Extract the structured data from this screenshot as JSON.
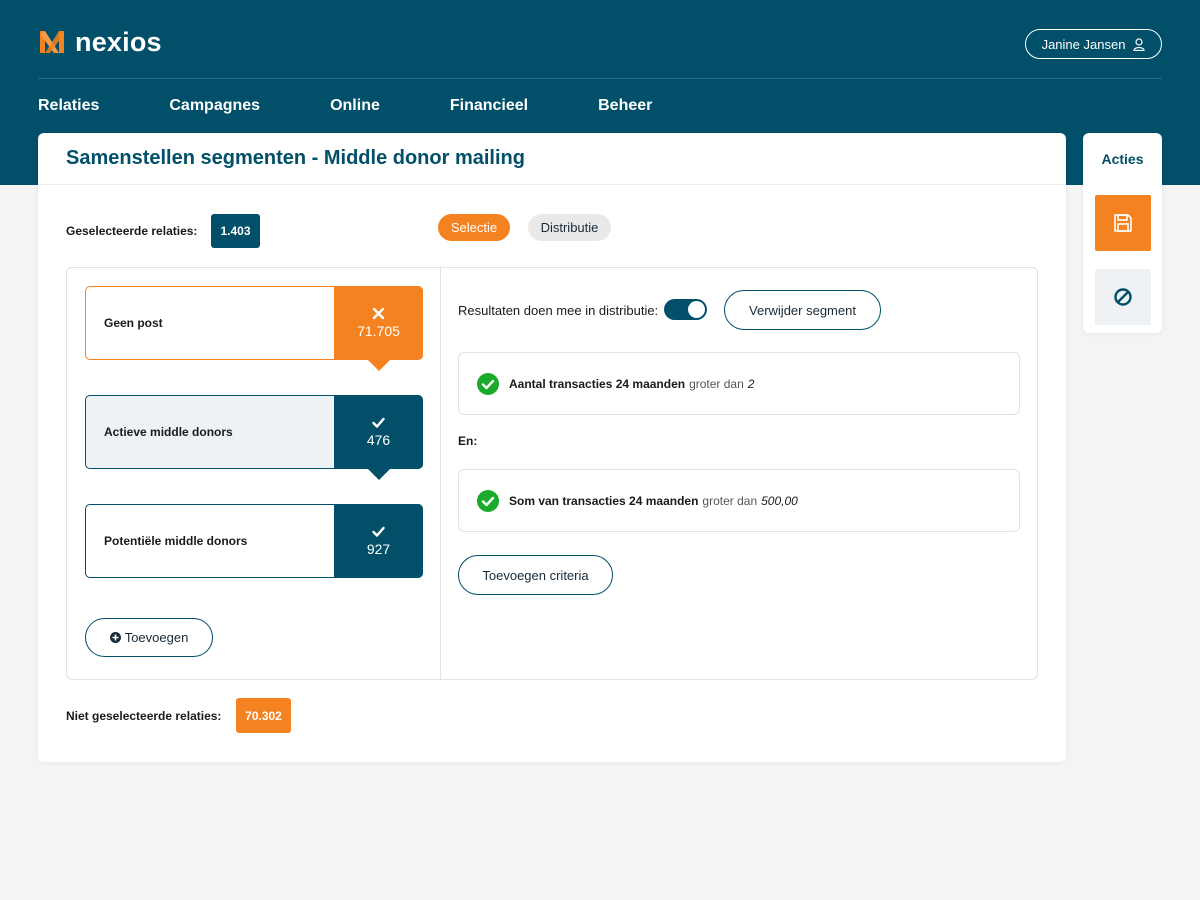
{
  "app": {
    "brand": "nexios",
    "user_name": "Janine Jansen"
  },
  "nav": [
    "Relaties",
    "Campagnes",
    "Online",
    "Financieel",
    "Beheer"
  ],
  "page": {
    "title": "Samenstellen segmenten - Middle donor mailing"
  },
  "selection": {
    "selected_label": "Geselecteerde relaties:",
    "selected_count": "1.403",
    "not_selected_label": "Niet geselecteerde relaties:",
    "not_selected_count": "70.302"
  },
  "tabs": {
    "selectie": "Selectie",
    "distributie": "Distributie"
  },
  "segments": [
    {
      "label": "Geen post",
      "count": "71.705",
      "icon": "x-icon"
    },
    {
      "label": "Actieve middle donors",
      "count": "476",
      "icon": "check-icon"
    },
    {
      "label": "Potentiële middle donors",
      "count": "927",
      "icon": "check-icon"
    }
  ],
  "add_button": "Toevoegen",
  "detail": {
    "results_label": "Resultaten doen mee in distributie:",
    "toggle_on": true,
    "delete_button": "Verwijder segment",
    "and_label": "En:",
    "add_criteria_button": "Toevoegen criteria",
    "criteria": [
      {
        "field": "Aantal transacties 24 maanden",
        "operator": "groter dan",
        "value": "2"
      },
      {
        "field": "Som van transacties 24 maanden",
        "operator": "groter dan",
        "value": "500,00"
      }
    ]
  },
  "actions": {
    "title": "Acties",
    "save_icon": "save-icon",
    "cancel_icon": "cancel-icon"
  },
  "colors": {
    "primary": "#014f69",
    "accent": "#f58220",
    "success": "#1aaa2c"
  }
}
